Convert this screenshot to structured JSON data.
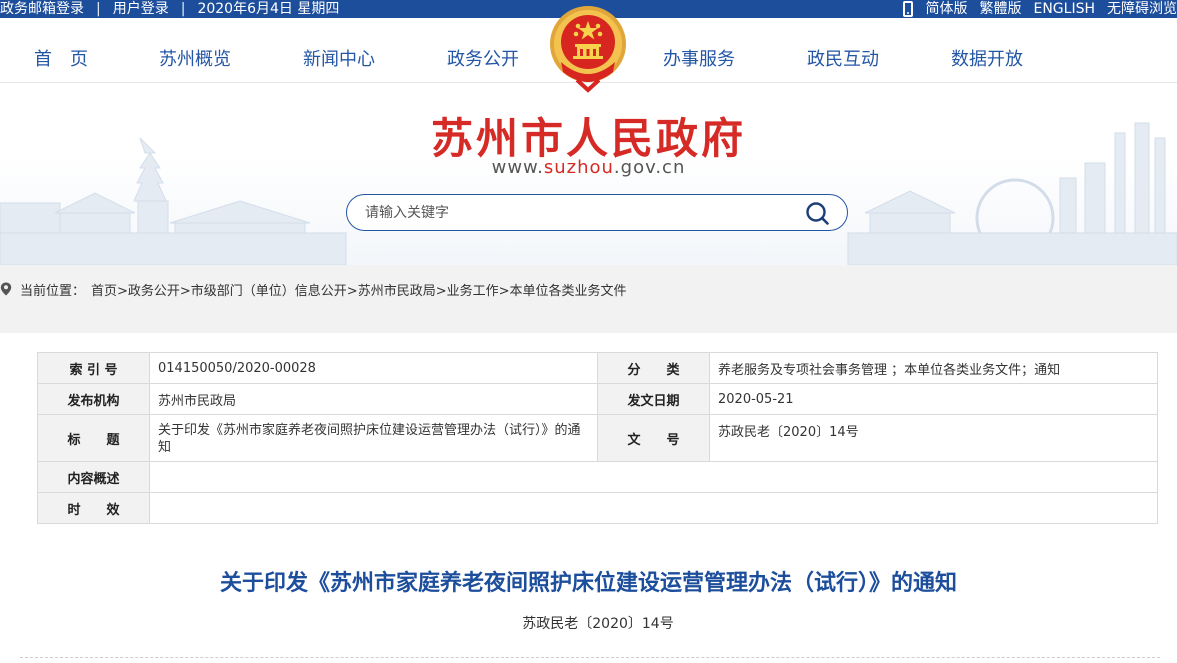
{
  "topbar": {
    "mail_login": "政务邮箱登录",
    "user_login": "用户登录",
    "date": "2020年6月4日 星期四",
    "simplified": "简体版",
    "traditional": "繁體版",
    "english": "ENGLISH",
    "accessible": "无障碍浏览",
    "color": "#1c4e9c"
  },
  "nav": {
    "items": [
      "首　页",
      "苏州概览",
      "新闻中心",
      "政务公开",
      "办事服务",
      "政民互动",
      "数据开放"
    ],
    "color": "#2456a6"
  },
  "banner": {
    "title": "苏州市人民政府",
    "url_prefix": "www.",
    "url_domain": "suzhou",
    "url_suffix": ".gov.cn",
    "title_color": "#d52a25"
  },
  "search": {
    "placeholder": "请输入关键字",
    "icon": "search-icon"
  },
  "breadcrumb": {
    "label": "当前位置：",
    "path": "首页>政务公开>市级部门（单位）信息公开>苏州市民政局>业务工作>本单位各类业务文件",
    "icon": "location-pin-icon"
  },
  "info": {
    "index_label": "索 引 号",
    "index_value": "014150050/2020-00028",
    "category_label": "分　　类",
    "category_value": "养老服务及专项社会事务管理 ；本单位各类业务文件；通知",
    "publisher_label": "发布机构",
    "publisher_value": "苏州市民政局",
    "date_label": "发文日期",
    "date_value": "2020-05-21",
    "title_label": "标　　题",
    "title_value": "关于印发《苏州市家庭养老夜间照护床位建设运营管理办法（试行）》的通知",
    "docno_label": "文　　号",
    "docno_value": "苏政民老〔2020〕14号",
    "summary_label": "内容概述",
    "summary_value": "",
    "validity_label": "时　　效",
    "validity_value": ""
  },
  "document": {
    "title": "关于印发《苏州市家庭养老夜间照护床位建设运营管理办法（试行）》的通知",
    "number": "苏政民老〔2020〕14号",
    "title_color": "#1c4e9c"
  }
}
